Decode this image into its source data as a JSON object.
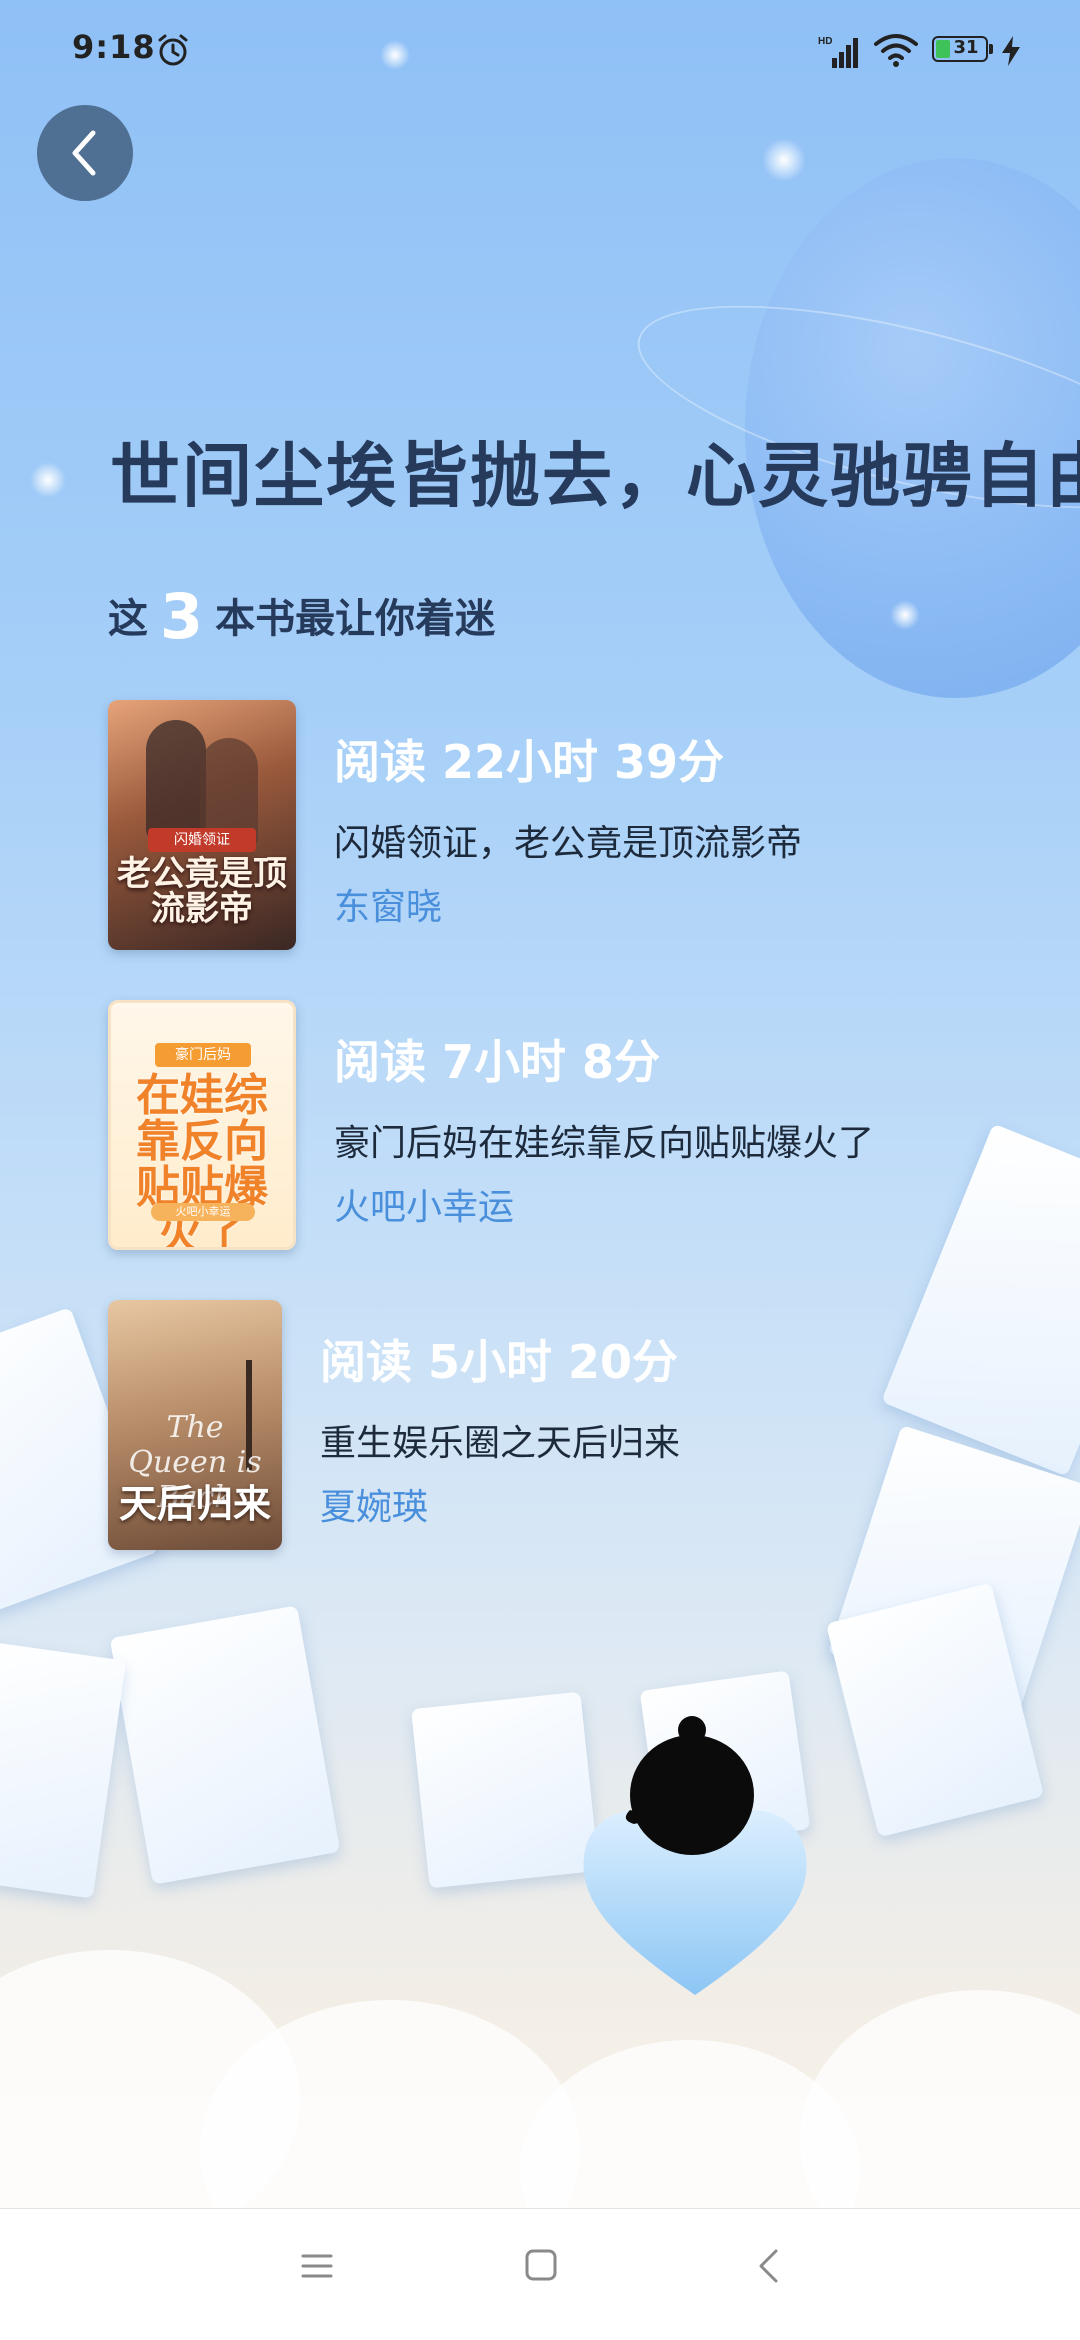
{
  "status_bar": {
    "time": "9:18",
    "battery_level": "31",
    "network_label": "HD",
    "icons": [
      "alarm-icon",
      "signal-icon",
      "wifi-icon",
      "battery-icon",
      "charging-bolt-icon"
    ]
  },
  "header": {
    "back_icon": "chevron-left-icon",
    "title": "世间尘埃皆抛去，心灵驰骋自由间",
    "subtitle_prefix": "这",
    "subtitle_count": "3",
    "subtitle_suffix": "本书最让你着迷"
  },
  "books": [
    {
      "reading_time": "阅读 22小时 39分",
      "title": "闪婚领证，老公竟是顶流影帝",
      "author": "东窗晓",
      "cover_text": "老公竟是顶流影帝",
      "cover_tag": "闪婚领证"
    },
    {
      "reading_time": "阅读 7小时 8分",
      "title": "豪门后妈在娃综靠反向贴贴爆火了",
      "author": "火吧小幸运",
      "cover_text": "在娃综靠反向贴贴爆火了",
      "cover_tag": "豪门后妈"
    },
    {
      "reading_time": "阅读 5小时 20分",
      "title": "重生娱乐圈之天后归来",
      "author": "夏婉瑛",
      "cover_text": "天后归来",
      "cover_en": "The Queen is Back"
    }
  ],
  "nav_bar": {
    "icons": [
      "menu-icon",
      "home-square-icon",
      "back-triangle-icon"
    ]
  },
  "colors": {
    "accent_text": "#4a8fdc",
    "title_text": "#263a5c",
    "back_button": "#4f6f93"
  }
}
